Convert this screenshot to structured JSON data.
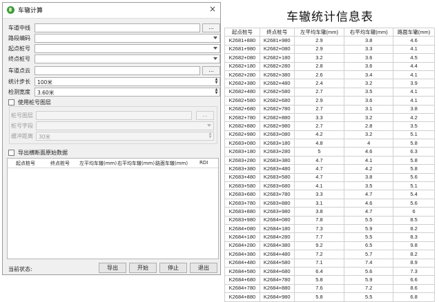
{
  "dialog": {
    "title": "车辙计算",
    "close_symbol": "×",
    "fields": {
      "lane_line_label": "车道中线",
      "lane_line_value": "",
      "lane_line_btn": "...",
      "section_code_label": "路段编码",
      "start_stake_label": "起点桩号",
      "end_stake_label": "终点桩号",
      "lane_points_label": "车道点云",
      "lane_points_value": "",
      "lane_points_btn": "...",
      "stat_step_label": "统计步长",
      "stat_step_value": "100米",
      "detect_width_label": "检测宽度",
      "detect_width_value": "3.60米",
      "use_stake_layer_label": "使用桩号图层"
    },
    "stake_group": {
      "layer_label": "桩号图层",
      "layer_btn": "...",
      "field_label": "桩号字段",
      "buffer_label": "缓冲距离",
      "buffer_value": "30米"
    },
    "export_label": "导出横断面原始数据",
    "list_columns": [
      "起点桩号",
      "终点桩号",
      "左平均车辙(mm)",
      "右平均车辙(mm)",
      "路面车辙(mm)",
      "RDI"
    ],
    "status_label": "当前状态:",
    "buttons": {
      "export": "导出",
      "start": "开始",
      "stop": "停止",
      "exit": "退出"
    }
  },
  "table": {
    "title": "车辙统计信息表",
    "headers": [
      "起点桩号",
      "终点桩号",
      "左平均车辙(mm)",
      "右平均车辙(mm)",
      "路面车辙(mm)"
    ],
    "rows": [
      [
        "K2681+880",
        "K2681+980",
        "2.9",
        "3.8",
        "4.6"
      ],
      [
        "K2681+980",
        "K2682+080",
        "2.9",
        "3.3",
        "4.1"
      ],
      [
        "K2682+080",
        "K2682+180",
        "3.2",
        "3.6",
        "4.5"
      ],
      [
        "K2682+180",
        "K2682+280",
        "2.8",
        "3.6",
        "4.4"
      ],
      [
        "K2682+280",
        "K2682+380",
        "2.6",
        "3.4",
        "4.1"
      ],
      [
        "K2682+380",
        "K2682+480",
        "2.4",
        "3.2",
        "3.9"
      ],
      [
        "K2682+480",
        "K2682+580",
        "2.7",
        "3.5",
        "4.1"
      ],
      [
        "K2682+580",
        "K2682+680",
        "2.9",
        "3.6",
        "4.1"
      ],
      [
        "K2682+680",
        "K2682+780",
        "2.7",
        "3.1",
        "3.8"
      ],
      [
        "K2682+780",
        "K2682+880",
        "3.3",
        "3.2",
        "4.2"
      ],
      [
        "K2682+880",
        "K2682+980",
        "2.7",
        "2.8",
        "3.5"
      ],
      [
        "K2682+980",
        "K2683+080",
        "4.2",
        "3.2",
        "5.1"
      ],
      [
        "K2683+080",
        "K2683+180",
        "4.8",
        "4",
        "5.8"
      ],
      [
        "K2683+180",
        "K2683+280",
        "5",
        "4.6",
        "6.3"
      ],
      [
        "K2683+280",
        "K2683+380",
        "4.7",
        "4.1",
        "5.8"
      ],
      [
        "K2683+380",
        "K2683+480",
        "4.7",
        "4.2",
        "5.8"
      ],
      [
        "K2683+480",
        "K2683+580",
        "4.7",
        "3.8",
        "5.6"
      ],
      [
        "K2683+580",
        "K2683+680",
        "4.1",
        "3.5",
        "5.1"
      ],
      [
        "K2683+680",
        "K2683+780",
        "3.3",
        "4.7",
        "5.4"
      ],
      [
        "K2683+780",
        "K2683+880",
        "3.1",
        "4.6",
        "5.6"
      ],
      [
        "K2683+880",
        "K2683+980",
        "3.8",
        "4.7",
        "6"
      ],
      [
        "K2683+980",
        "K2684+080",
        "7.8",
        "5.5",
        "8.5"
      ],
      [
        "K2684+080",
        "K2684+180",
        "7.3",
        "5.9",
        "8.2"
      ],
      [
        "K2684+180",
        "K2684+280",
        "7.7",
        "5.5",
        "8.3"
      ],
      [
        "K2684+280",
        "K2684+380",
        "9.2",
        "6.5",
        "9.8"
      ],
      [
        "K2684+380",
        "K2684+480",
        "7.2",
        "5.7",
        "8.2"
      ],
      [
        "K2684+480",
        "K2684+580",
        "7.1",
        "7.4",
        "8.9"
      ],
      [
        "K2684+580",
        "K2684+680",
        "6.4",
        "5.6",
        "7.3"
      ],
      [
        "K2684+680",
        "K2684+780",
        "5.8",
        "5.9",
        "6.6"
      ],
      [
        "K2684+780",
        "K2684+880",
        "7.6",
        "7.2",
        "8.6"
      ],
      [
        "K2684+880",
        "K2684+980",
        "5.8",
        "5.5",
        "6.8"
      ]
    ]
  }
}
